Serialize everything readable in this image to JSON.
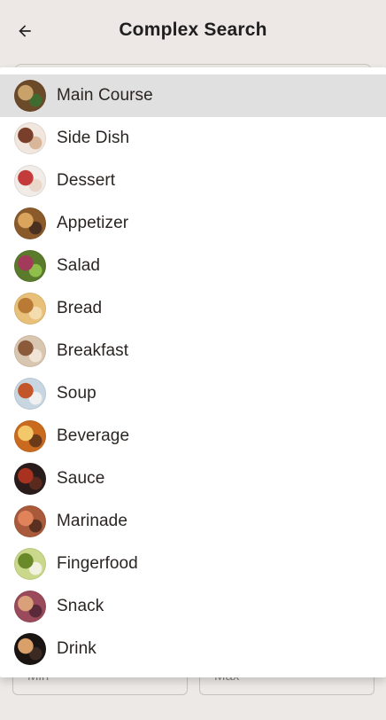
{
  "header": {
    "title": "Complex Search",
    "back_icon": "arrow-left-icon"
  },
  "dropdown": {
    "selected_index": 0,
    "items": [
      {
        "label": "Main Course",
        "icon": "main-course-thumbnail",
        "colors": [
          "#6b4a2a",
          "#c9a16a",
          "#3f6b2e"
        ]
      },
      {
        "label": "Side Dish",
        "icon": "side-dish-thumbnail",
        "colors": [
          "#f1e7df",
          "#7a3f2a",
          "#d8b69a"
        ]
      },
      {
        "label": "Dessert",
        "icon": "dessert-thumbnail",
        "colors": [
          "#f2ece8",
          "#c43b3b",
          "#e9d7c9"
        ]
      },
      {
        "label": "Appetizer",
        "icon": "appetizer-thumbnail",
        "colors": [
          "#8a5a2b",
          "#d9a45c",
          "#4a3020"
        ]
      },
      {
        "label": "Salad",
        "icon": "salad-thumbnail",
        "colors": [
          "#5a7a2c",
          "#a23a5a",
          "#8fbf4a"
        ]
      },
      {
        "label": "Bread",
        "icon": "bread-thumbnail",
        "colors": [
          "#e8c07a",
          "#b97a35",
          "#f4dcae"
        ]
      },
      {
        "label": "Breakfast",
        "icon": "breakfast-thumbnail",
        "colors": [
          "#d9c6b0",
          "#8a5a3a",
          "#efe4d6"
        ]
      },
      {
        "label": "Soup",
        "icon": "soup-thumbnail",
        "colors": [
          "#c8d6e2",
          "#c2552a",
          "#f0f0f0"
        ]
      },
      {
        "label": "Beverage",
        "icon": "beverage-thumbnail",
        "colors": [
          "#c96a1e",
          "#f2c86a",
          "#6b3a18"
        ]
      },
      {
        "label": "Sauce",
        "icon": "sauce-thumbnail",
        "colors": [
          "#2a1c1a",
          "#a8321f",
          "#5a2a1e"
        ]
      },
      {
        "label": "Marinade",
        "icon": "marinade-thumbnail",
        "colors": [
          "#a85a3a",
          "#e0825a",
          "#5a3020"
        ]
      },
      {
        "label": "Fingerfood",
        "icon": "fingerfood-thumbnail",
        "colors": [
          "#c9d88a",
          "#6a8a2a",
          "#f2f2e0"
        ]
      },
      {
        "label": "Snack",
        "icon": "snack-thumbnail",
        "colors": [
          "#9a4a5a",
          "#d9a07a",
          "#5a2a3a"
        ]
      },
      {
        "label": "Drink",
        "icon": "drink-thumbnail",
        "colors": [
          "#1a1412",
          "#d9a06a",
          "#3a2a22"
        ]
      }
    ]
  },
  "underlying_fields": {
    "min_placeholder": "Min",
    "max_placeholder": "Max"
  },
  "colors": {
    "appbar_bg": "#ede8e5",
    "page_bg": "#ede9e6",
    "menu_bg": "#ffffff",
    "selected_bg": "#e1e0e0",
    "text": "#2a2522"
  }
}
